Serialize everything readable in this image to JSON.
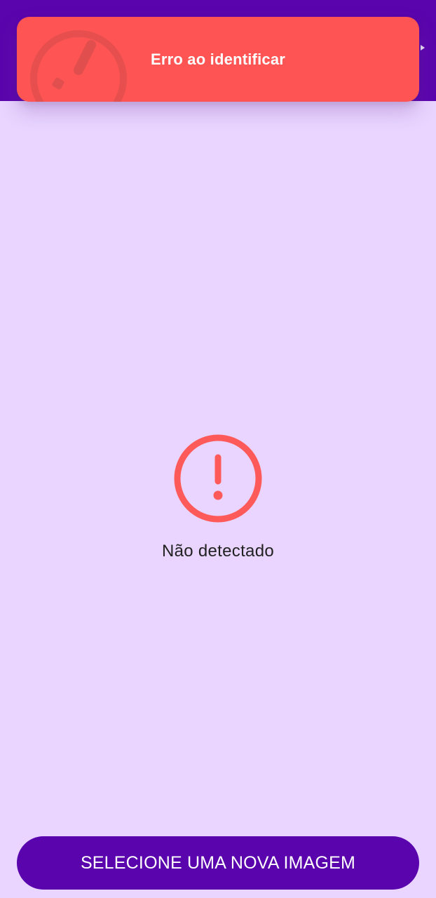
{
  "app": {
    "background_color": "#e9d5ff",
    "header_color": "#5a04ad"
  },
  "toast": {
    "message": "Erro ao identificar",
    "background_color": "#ff5454",
    "icon": "alert-circle-icon"
  },
  "status": {
    "icon": "alert-circle-icon",
    "icon_color": "#ff5a5a",
    "text": "Não detectado"
  },
  "action": {
    "button_label": "SELECIONE UMA NOVA IMAGEM",
    "button_color": "#5a04ad"
  }
}
